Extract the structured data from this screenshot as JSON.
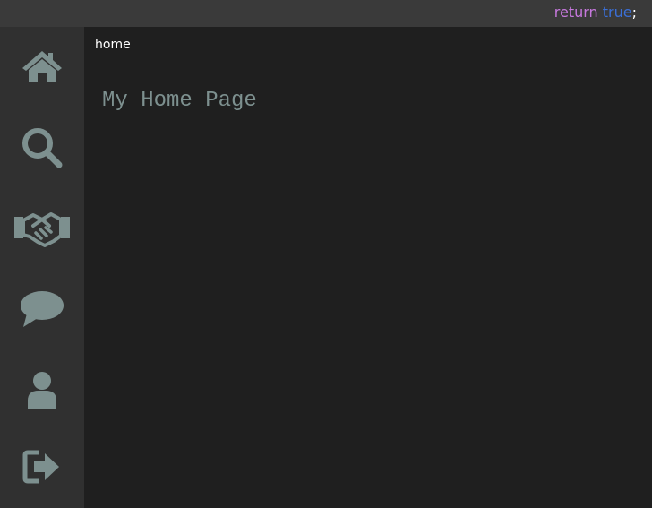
{
  "header": {
    "brand": {
      "keyword": "return",
      "value": "true",
      "terminator": ";"
    }
  },
  "sidebar": {
    "items": [
      {
        "icon": "home-icon"
      },
      {
        "icon": "search-icon"
      },
      {
        "icon": "handshake-icon"
      },
      {
        "icon": "chat-bubble-icon"
      },
      {
        "icon": "user-icon"
      },
      {
        "icon": "sign-out-icon"
      }
    ]
  },
  "main": {
    "breadcrumb": "home",
    "title": "My Home Page"
  },
  "colors": {
    "topbar": "#3a3a3a",
    "sidebar": "#303030",
    "content": "#1f1f1f",
    "icon": "#7d908f",
    "keyword": "#c678dd",
    "value": "#3b6fd6"
  }
}
